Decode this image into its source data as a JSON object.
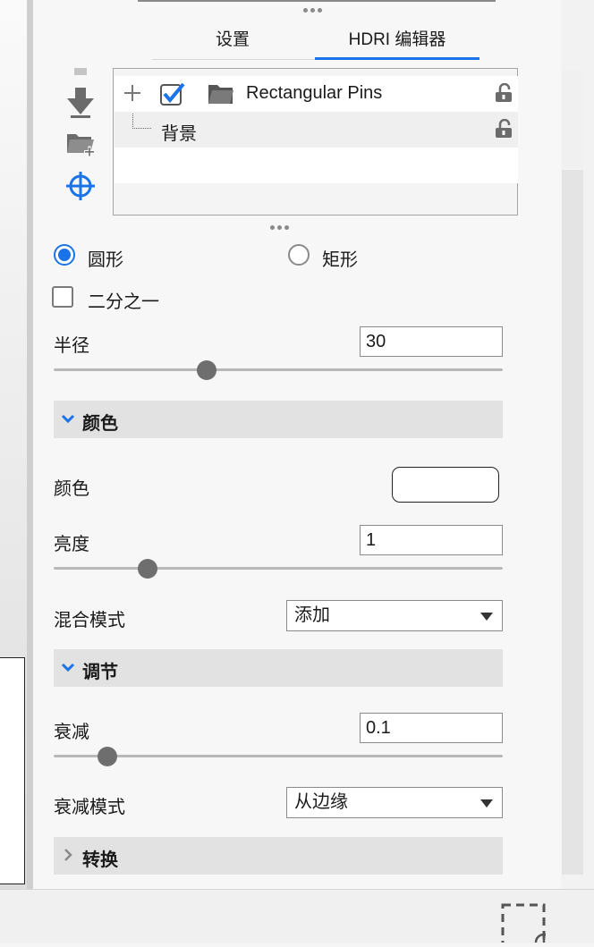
{
  "tabs": [
    {
      "label": "设置",
      "active": false
    },
    {
      "label": "HDRI 编辑器",
      "active": true
    }
  ],
  "accent_color": "#1a73e8",
  "tools": [
    "arrow-down-icon",
    "folder-add-icon",
    "crosshair-icon"
  ],
  "tree": {
    "rows": [
      {
        "label": "Rectangular Pins",
        "checked": true,
        "icon": "folder-icon",
        "locked": true
      },
      {
        "label": "背景",
        "icon": "tree-branch-icon",
        "locked": true
      }
    ]
  },
  "shape": {
    "options": [
      "圆形",
      "矩形"
    ],
    "selected": "圆形"
  },
  "half": {
    "label": "二分之一",
    "checked": false
  },
  "radius": {
    "label": "半径",
    "value": "30",
    "slider_fraction": 0.34
  },
  "sections": {
    "color": {
      "title": "颜色",
      "expanded": true
    },
    "adjust": {
      "title": "调节",
      "expanded": true
    },
    "transform": {
      "title": "转换",
      "expanded": false
    }
  },
  "color": {
    "label": "颜色",
    "value": "#ffffff"
  },
  "brightness": {
    "label": "亮度",
    "value": "1",
    "slider_fraction": 0.21
  },
  "blend_mode": {
    "label": "混合模式",
    "value": "添加"
  },
  "falloff": {
    "label": "衰减",
    "value": "0.1",
    "slider_fraction": 0.12
  },
  "falloff_mode": {
    "label": "衰减模式",
    "value": "从边缘"
  }
}
